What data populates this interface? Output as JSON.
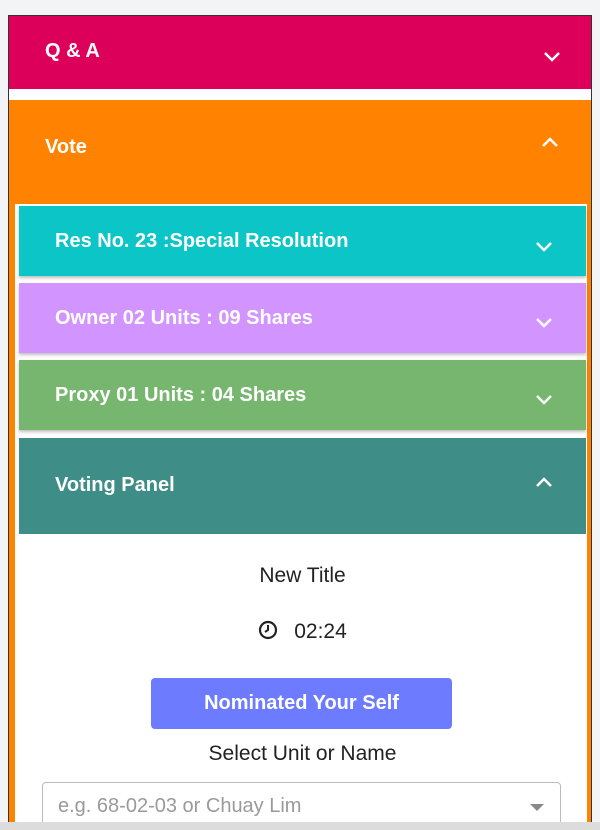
{
  "sections": {
    "qa": {
      "label": "Q & A",
      "color": "#dc005a",
      "expanded": false
    },
    "vote": {
      "label": "Vote",
      "color": "#ff8200",
      "expanded": true
    }
  },
  "vote": {
    "cards": {
      "resolution": {
        "label": "Res No. 23 :Special Resolution",
        "color": "#0cc5c6",
        "expanded": false
      },
      "owner": {
        "label": "Owner 02 Units : 09 Shares",
        "color": "#d295ff",
        "expanded": false
      },
      "proxy": {
        "label": "Proxy 01 Units : 04 Shares",
        "color": "#76b66e",
        "expanded": false
      },
      "voting_panel": {
        "label": "Voting Panel",
        "color": "#3e8e87",
        "expanded": true
      }
    },
    "panel": {
      "title": "New Title",
      "timer": "02:24",
      "timer_icon": "clock-icon",
      "nominate_button": "Nominated Your Self",
      "nominate_color": "#6c7bff",
      "select_label": "Select Unit or Name",
      "select_placeholder": "e.g. 68-02-03 or Chuay Lim",
      "select_value": ""
    }
  }
}
